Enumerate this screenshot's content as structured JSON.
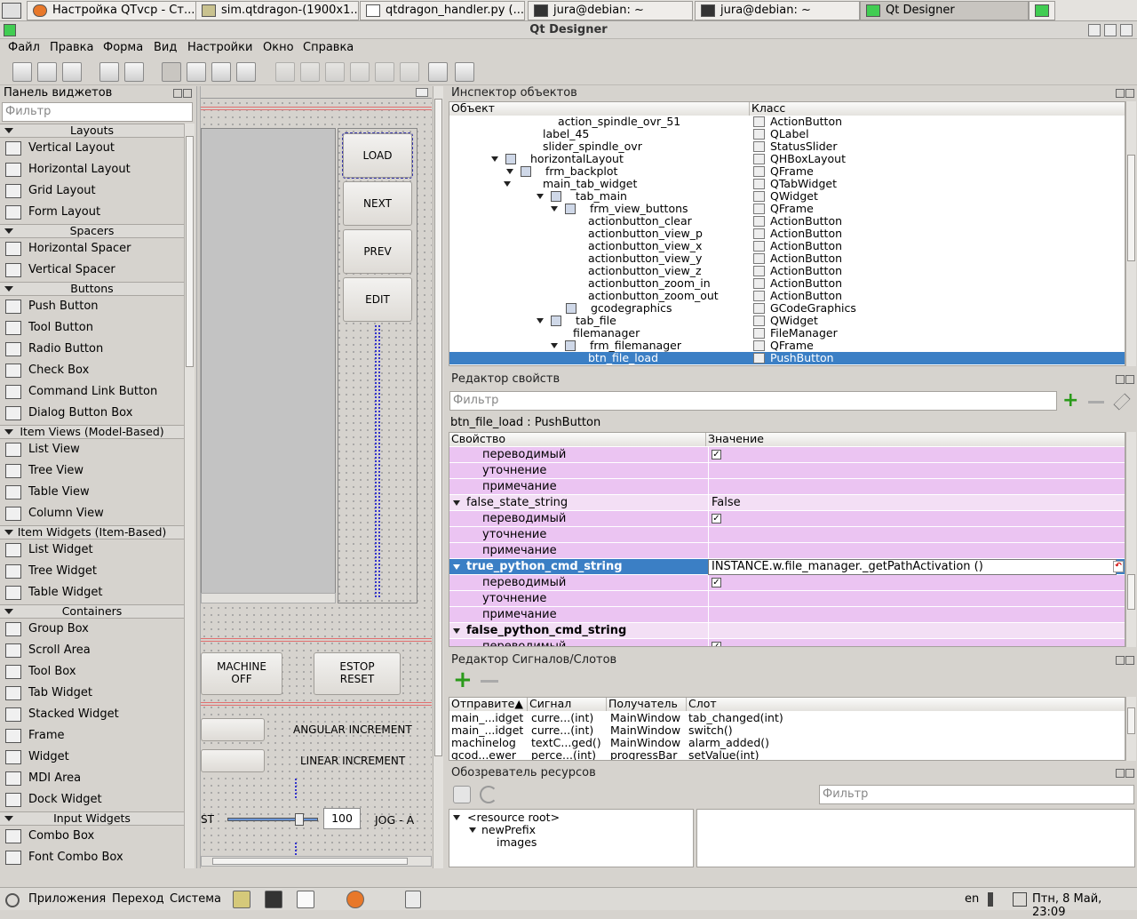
{
  "browser_tabs": [
    {
      "label": "Настройка QTvcp - Ст...",
      "active": false
    },
    {
      "label": "sim.qtdragon-(1900x1...",
      "active": false
    },
    {
      "label": "qtdragon_handler.py (...",
      "active": false
    },
    {
      "label": "jura@debian: ~",
      "active": false
    },
    {
      "label": "jura@debian: ~",
      "active": false
    },
    {
      "label": "Qt Designer",
      "active": true
    }
  ],
  "window": {
    "title": "Qt Designer"
  },
  "menu": [
    "Файл",
    "Правка",
    "Форма",
    "Вид",
    "Настройки",
    "Окно",
    "Справка"
  ],
  "widget_box": {
    "title": "Панель виджетов",
    "filter_placeholder": "Фильтр",
    "categories": [
      {
        "name": "Layouts",
        "items": [
          "Vertical Layout",
          "Horizontal Layout",
          "Grid Layout",
          "Form Layout"
        ]
      },
      {
        "name": "Spacers",
        "items": [
          "Horizontal Spacer",
          "Vertical Spacer"
        ]
      },
      {
        "name": "Buttons",
        "items": [
          "Push Button",
          "Tool Button",
          "Radio Button",
          "Check Box",
          "Command Link Button",
          "Dialog Button Box"
        ]
      },
      {
        "name": "Item Views (Model-Based)",
        "items": [
          "List View",
          "Tree View",
          "Table View",
          "Column View"
        ]
      },
      {
        "name": "Item Widgets (Item-Based)",
        "items": [
          "List Widget",
          "Tree Widget",
          "Table Widget"
        ]
      },
      {
        "name": "Containers",
        "items": [
          "Group Box",
          "Scroll Area",
          "Tool Box",
          "Tab Widget",
          "Stacked Widget",
          "Frame",
          "Widget",
          "MDI Area",
          "Dock Widget"
        ]
      },
      {
        "name": "Input Widgets",
        "items": [
          "Combo Box",
          "Font Combo Box"
        ]
      }
    ]
  },
  "form": {
    "buttons": [
      "LOAD",
      "NEXT",
      "PREV",
      "EDIT"
    ],
    "machine_off": "MACHINE\nOFF",
    "estop_reset": "ESTOP\nRESET",
    "angular_increment": "ANGULAR INCREMENT",
    "linear_increment": "LINEAR INCREMENT",
    "jog_value": "100",
    "jog_label": "JOG - A",
    "partial_label": "ST"
  },
  "object_inspector": {
    "title": "Инспектор объектов",
    "col_object": "Объект",
    "col_class": "Класс",
    "rows": [
      {
        "obj": "action_spindle_ovr_51",
        "cls": "ActionButton",
        "indent": 122,
        "arrow": false
      },
      {
        "obj": "label_45",
        "cls": "QLabel",
        "indent": 105,
        "arrow": false
      },
      {
        "obj": "slider_spindle_ovr",
        "cls": "StatusSlider",
        "indent": 105,
        "arrow": false
      },
      {
        "obj": "horizontalLayout",
        "cls": "QHBoxLayout",
        "indent": 91,
        "arrow": true,
        "icon": true
      },
      {
        "obj": "frm_backplot",
        "cls": "QFrame",
        "indent": 108,
        "arrow": true,
        "icon": true
      },
      {
        "obj": "main_tab_widget",
        "cls": "QTabWidget",
        "indent": 105,
        "arrow": true,
        "icon": false
      },
      {
        "obj": "tab_main",
        "cls": "QWidget",
        "indent": 142,
        "arrow": true,
        "icon": true
      },
      {
        "obj": "frm_view_buttons",
        "cls": "QFrame",
        "indent": 158,
        "arrow": true,
        "icon": true
      },
      {
        "obj": "actionbutton_clear",
        "cls": "ActionButton",
        "indent": 156,
        "arrow": false
      },
      {
        "obj": "actionbutton_view_p",
        "cls": "ActionButton",
        "indent": 156,
        "arrow": false
      },
      {
        "obj": "actionbutton_view_x",
        "cls": "ActionButton",
        "indent": 156,
        "arrow": false
      },
      {
        "obj": "actionbutton_view_y",
        "cls": "ActionButton",
        "indent": 156,
        "arrow": false
      },
      {
        "obj": "actionbutton_view_z",
        "cls": "ActionButton",
        "indent": 156,
        "arrow": false
      },
      {
        "obj": "actionbutton_zoom_in",
        "cls": "ActionButton",
        "indent": 156,
        "arrow": false
      },
      {
        "obj": "actionbutton_zoom_out",
        "cls": "ActionButton",
        "indent": 156,
        "arrow": false
      },
      {
        "obj": "gcodegraphics",
        "cls": "GCodeGraphics",
        "indent": 159,
        "arrow": false,
        "icon": true
      },
      {
        "obj": "tab_file",
        "cls": "QWidget",
        "indent": 142,
        "arrow": true,
        "icon": true
      },
      {
        "obj": "filemanager",
        "cls": "FileManager",
        "indent": 139,
        "arrow": false
      },
      {
        "obj": "frm_filemanager",
        "cls": "QFrame",
        "indent": 158,
        "arrow": true,
        "icon": true
      },
      {
        "obj": "btn_file_load",
        "cls": "PushButton",
        "indent": 156,
        "arrow": false,
        "selected": true
      }
    ]
  },
  "property_editor": {
    "title": "Редактор свойств",
    "filter_placeholder": "Фильтр",
    "object_label": "btn_file_load : PushButton",
    "col_property": "Свойство",
    "col_value": "Значение",
    "rows": [
      {
        "name": "переводимый",
        "value": "✓",
        "sub": true,
        "check": true
      },
      {
        "name": "уточнение",
        "value": "",
        "sub": true
      },
      {
        "name": "примечание",
        "value": "",
        "sub": true
      },
      {
        "name": "false_state_string",
        "value": "False",
        "sub": false
      },
      {
        "name": "переводимый",
        "value": "✓",
        "sub": true,
        "check": true
      },
      {
        "name": "уточнение",
        "value": "",
        "sub": true
      },
      {
        "name": "примечание",
        "value": "",
        "sub": true
      },
      {
        "name": "true_python_cmd_string",
        "value": "INSTANCE.w.file_manager._getPathActivation ()",
        "sub": false,
        "selected": true
      },
      {
        "name": "переводимый",
        "value": "✓",
        "sub": true,
        "check": true
      },
      {
        "name": "уточнение",
        "value": "",
        "sub": true
      },
      {
        "name": "примечание",
        "value": "",
        "sub": true
      },
      {
        "name": "false_python_cmd_string",
        "value": "",
        "sub": false,
        "bold": true
      },
      {
        "name": "переводимый",
        "value": "✓",
        "sub": true,
        "check": true
      }
    ]
  },
  "signal_slot_editor": {
    "title": "Редактор Сигналов/Слотов",
    "headers": [
      "Отправите▲",
      "Сигнал",
      "Получатель",
      "Слот"
    ],
    "rows": [
      [
        "main_...idget",
        "curre...(int)",
        "MainWindow",
        "tab_changed(int)"
      ],
      [
        "main_...idget",
        "curre...(int)",
        "MainWindow",
        "switch()"
      ],
      [
        "machinelog",
        "textC...ged()",
        "MainWindow",
        "alarm_added()"
      ],
      [
        "gcod...ewer",
        "perce...(int)",
        "progressBar",
        "setValue(int)"
      ]
    ]
  },
  "resource_browser": {
    "title": "Обозреватель ресурсов",
    "filter_placeholder": "Фильтр",
    "tree": [
      "<resource root>",
      "newPrefix",
      "images"
    ]
  },
  "taskbar": {
    "menu": [
      "Приложения",
      "Переход",
      "Система"
    ],
    "lang": "en",
    "clock": "Птн, 8 Май, 23:09"
  }
}
